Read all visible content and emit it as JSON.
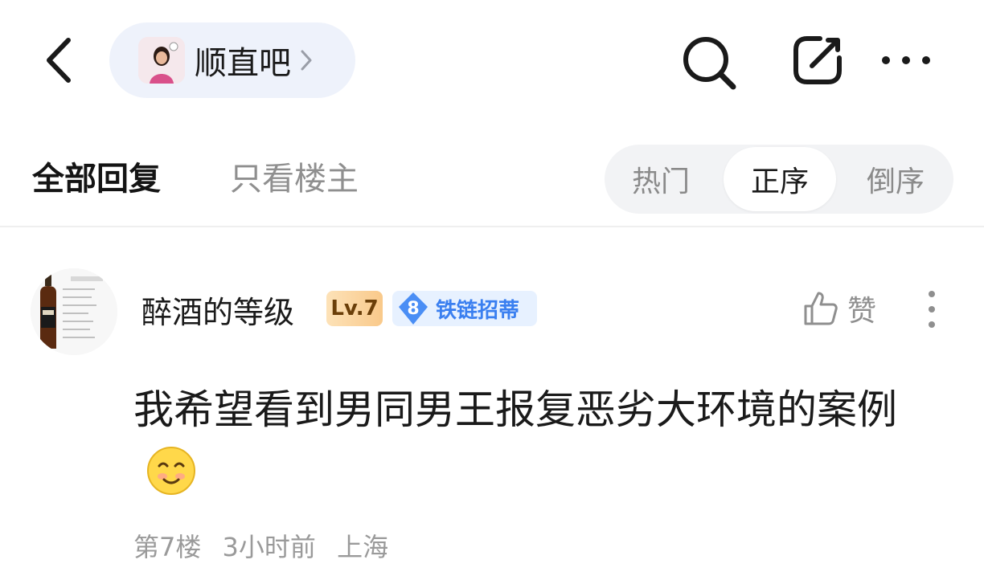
{
  "header": {
    "forum_name": "顺直吧",
    "icons": {
      "back": "chevron-left-icon",
      "forum_chevron": "chevron-right-icon",
      "search": "search-icon",
      "share": "share-icon",
      "more": "more-horizontal-icon"
    }
  },
  "filter": {
    "tabs": [
      "全部回复",
      "只看楼主"
    ],
    "active_tab": "全部回复",
    "sort": [
      "热门",
      "正序",
      "倒序"
    ],
    "active_sort": "正序"
  },
  "post": {
    "username": "醉酒的等级",
    "level": "Lv.7",
    "title_level": "8",
    "title": "铁链招蒂",
    "like_label": "赞",
    "content": "我希望看到男同男王报复恶劣大环境的案例",
    "emoji": "smiley-emoji",
    "floor": "第7楼",
    "time": "3小时前",
    "location": "上海"
  },
  "colors": {
    "accent_blue": "#3a7ff0",
    "level_badge": "#f9c98a",
    "pill_bg": "#eef2fb",
    "muted_text": "#9a9a9a"
  }
}
